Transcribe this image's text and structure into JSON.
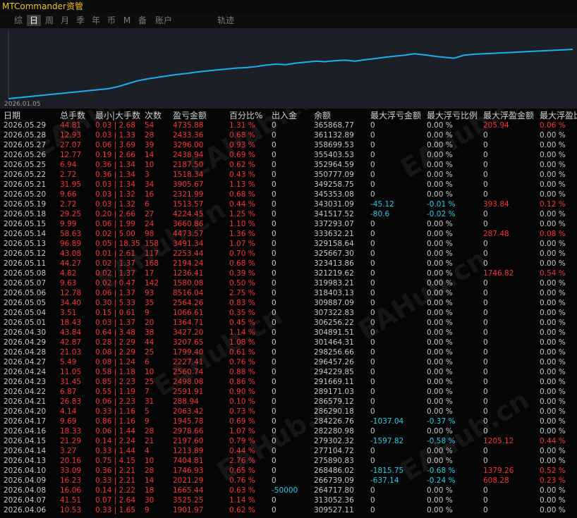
{
  "window": {
    "title": "MTCommander资管"
  },
  "tabs": [
    {
      "label": "综",
      "active": false
    },
    {
      "label": "日",
      "active": true
    },
    {
      "label": "周",
      "active": false
    },
    {
      "label": "月",
      "active": false
    },
    {
      "label": "季",
      "active": false
    },
    {
      "label": "年",
      "active": false
    },
    {
      "label": "币",
      "active": false
    },
    {
      "label": "M",
      "active": false
    },
    {
      "label": "备",
      "active": false
    },
    {
      "label": "账户",
      "active": false
    },
    {
      "label": "轨迹",
      "active": false
    }
  ],
  "chart_data": {
    "type": "line",
    "x_start_label": "2026.01.05",
    "series_color": "#1ab0f0",
    "values": [
      0.0,
      0.02,
      0.04,
      0.06,
      0.08,
      0.1,
      0.12,
      0.14,
      0.16,
      0.18,
      0.2,
      0.24,
      0.3,
      0.36,
      0.4,
      0.43,
      0.46,
      0.49,
      0.51,
      0.54,
      0.56,
      0.58,
      0.6,
      0.62,
      0.63,
      0.65,
      0.68,
      0.7,
      0.69,
      0.72,
      0.74,
      0.76,
      0.75,
      0.77,
      0.78,
      0.76,
      0.79,
      0.81,
      0.84,
      0.86,
      0.88,
      0.91,
      0.89,
      0.86,
      0.84,
      0.82,
      0.88,
      0.9,
      0.91,
      0.92,
      0.93,
      0.94,
      0.95,
      0.96,
      0.97,
      0.98,
      0.99,
      1.0
    ]
  },
  "watermark": "EAHub.cn",
  "table": {
    "headers": [
      "日期",
      "总手数",
      "最小|大手数",
      "次数",
      "盈亏金额",
      "百分比%",
      "出入金",
      "余额",
      "最大浮亏金额",
      "最大浮亏比例",
      "最大浮盈金额",
      "最大浮盈比"
    ],
    "rows": [
      [
        "2026.05.29",
        "44.81",
        "0.03 | 2.68",
        "54",
        "4735.88",
        "1.31 %",
        "0",
        "365868.77",
        "0",
        "0.00 %",
        "205.94",
        "0.06 %"
      ],
      [
        "2026.05.28",
        "12.93",
        "0.03 | 1.33",
        "28",
        "2433.36",
        "0.68 %",
        "0",
        "361132.89",
        "0",
        "0.00 %",
        "0",
        "0.00 %"
      ],
      [
        "2026.05.27",
        "27.07",
        "0.06 | 3.69",
        "39",
        "3296.00",
        "0.93 %",
        "0",
        "358699.53",
        "0",
        "0.00 %",
        "0",
        "0.00 %"
      ],
      [
        "2026.05.26",
        "12.77",
        "0.19 | 2.66",
        "14",
        "2438.94",
        "0.69 %",
        "0",
        "355403.53",
        "0",
        "0.00 %",
        "0",
        "0.00 %"
      ],
      [
        "2026.05.25",
        "6.94",
        "0.36 | 1.34",
        "10",
        "2187.50",
        "0.62 %",
        "0",
        "352964.59",
        "0",
        "0.00 %",
        "0",
        "0.00 %"
      ],
      [
        "2026.05.22",
        "2.72",
        "0.36 | 1.34",
        "3",
        "1518.34",
        "0.43 %",
        "0",
        "350777.09",
        "0",
        "0.00 %",
        "0",
        "0.00 %"
      ],
      [
        "2026.05.21",
        "31.95",
        "0.03 | 1.34",
        "34",
        "3905.67",
        "1.13 %",
        "0",
        "349258.75",
        "0",
        "0.00 %",
        "0",
        "0.00 %"
      ],
      [
        "2026.05.20",
        "9.66",
        "0.03 | 1.32",
        "16",
        "2321.99",
        "0.68 %",
        "0",
        "345353.08",
        "0",
        "0.00 %",
        "0",
        "0.00 %"
      ],
      [
        "2026.05.19",
        "2.72",
        "0.03 | 1.32",
        "6",
        "1513.57",
        "0.44 %",
        "0",
        "343031.09",
        "-45.12",
        "-0.01 %",
        "393.84",
        "0.12 %"
      ],
      [
        "2026.05.18",
        "29.25",
        "0.20 | 2.66",
        "27",
        "4224.45",
        "1.25 %",
        "0",
        "341517.52",
        "-80.6",
        "-0.02 %",
        "0",
        "0.00 %"
      ],
      [
        "2026.05.15",
        "9.99",
        "0.06 | 1.99",
        "24",
        "3660.86",
        "1.10 %",
        "0",
        "337293.07",
        "0",
        "0.00 %",
        "0",
        "0.00 %"
      ],
      [
        "2026.05.14",
        "58.63",
        "0.02 | 5.00",
        "98",
        "4473.57",
        "1.36 %",
        "0",
        "333632.21",
        "0",
        "0.00 %",
        "287.48",
        "0.08 %"
      ],
      [
        "2026.05.13",
        "96.89",
        "0.05 | 18.35",
        "158",
        "3491.34",
        "1.07 %",
        "0",
        "329158.64",
        "0",
        "0.00 %",
        "0",
        "0.00 %"
      ],
      [
        "2026.05.12",
        "43.08",
        "0.01 | 2.61",
        "117",
        "2253.44",
        "0.70 %",
        "0",
        "325667.30",
        "0",
        "0.00 %",
        "0",
        "0.00 %"
      ],
      [
        "2026.05.11",
        "44.27",
        "0.02 | 1.37",
        "168",
        "2194.24",
        "0.68 %",
        "0",
        "323413.86",
        "0",
        "0.00 %",
        "0",
        "0.00 %"
      ],
      [
        "2026.05.08",
        "4.82",
        "0.02 | 1.37",
        "17",
        "1236.41",
        "0.39 %",
        "0",
        "321219.62",
        "0",
        "0.00 %",
        "1746.82",
        "0.54 %"
      ],
      [
        "2026.05.07",
        "9.63",
        "0.02 | 0.47",
        "142",
        "1580.08",
        "0.50 %",
        "0",
        "319983.21",
        "0",
        "0.00 %",
        "0",
        "0.00 %"
      ],
      [
        "2026.05.06",
        "12.78",
        "0.06 | 1.37",
        "93",
        "8516.04",
        "2.75 %",
        "0",
        "318403.13",
        "0",
        "0.00 %",
        "0",
        "0.00 %"
      ],
      [
        "2026.05.05",
        "34.40",
        "0.30 | 5.33",
        "35",
        "2564.26",
        "0.83 %",
        "0",
        "309887.09",
        "0",
        "0.00 %",
        "0",
        "0.00 %"
      ],
      [
        "2026.05.04",
        "3.51",
        "0.15 | 0.61",
        "9",
        "1066.61",
        "0.35 %",
        "0",
        "307322.83",
        "0",
        "0.00 %",
        "0",
        "0.00 %"
      ],
      [
        "2026.05.01",
        "18.43",
        "0.03 | 1.37",
        "20",
        "1364.71",
        "0.45 %",
        "0",
        "306256.22",
        "0",
        "0.00 %",
        "0",
        "0.00 %"
      ],
      [
        "2026.04.30",
        "43.84",
        "0.64 | 3.48",
        "38",
        "3427.20",
        "1.14 %",
        "0",
        "304891.51",
        "0",
        "0.00 %",
        "0",
        "0.00 %"
      ],
      [
        "2026.04.29",
        "42.87",
        "0.28 | 2.29",
        "44",
        "3207.65",
        "1.08 %",
        "0",
        "301464.31",
        "0",
        "0.00 %",
        "0",
        "0.00 %"
      ],
      [
        "2026.04.28",
        "21.03",
        "0.08 | 2.29",
        "25",
        "1799.40",
        "0.61 %",
        "0",
        "298256.66",
        "0",
        "0.00 %",
        "0",
        "0.00 %"
      ],
      [
        "2026.04.27",
        "5.49",
        "0.08 | 1.24",
        "6",
        "2227.41",
        "0.76 %",
        "0",
        "296457.26",
        "0",
        "0.00 %",
        "0",
        "0.00 %"
      ],
      [
        "2026.04.24",
        "11.05",
        "0.58 | 1.18",
        "10",
        "2560.74",
        "0.88 %",
        "0",
        "294229.85",
        "0",
        "0.00 %",
        "0",
        "0.00 %"
      ],
      [
        "2026.04.23",
        "31.45",
        "0.85 | 2.23",
        "25",
        "2498.08",
        "0.86 %",
        "0",
        "291669.11",
        "0",
        "0.00 %",
        "0",
        "0.00 %"
      ],
      [
        "2026.04.22",
        "6.87",
        "0.55 | 1.19",
        "7",
        "2591.91",
        "0.90 %",
        "0",
        "289171.03",
        "0",
        "0.00 %",
        "0",
        "0.00 %"
      ],
      [
        "2026.04.21",
        "26.83",
        "0.06 | 2.23",
        "31",
        "288.94",
        "0.10 %",
        "0",
        "286579.12",
        "0",
        "0.00 %",
        "0",
        "0.00 %"
      ],
      [
        "2026.04.20",
        "4.14",
        "0.33 | 1.16",
        "5",
        "2063.42",
        "0.73 %",
        "0",
        "286290.18",
        "0",
        "0.00 %",
        "0",
        "0.00 %"
      ],
      [
        "2026.04.17",
        "9.69",
        "0.86 | 1.16",
        "9",
        "1945.78",
        "0.69 %",
        "0",
        "284226.76",
        "-1037.04",
        "-0.37 %",
        "0",
        "0.00 %"
      ],
      [
        "2026.04.16",
        "18.33",
        "0.06 | 1.44",
        "28",
        "2978.66",
        "1.07 %",
        "0",
        "282280.98",
        "0",
        "0.00 %",
        "0",
        "0.00 %"
      ],
      [
        "2026.04.15",
        "21.29",
        "0.14 | 2.24",
        "21",
        "2197.60",
        "0.79 %",
        "0",
        "279302.32",
        "-1597.82",
        "-0.58 %",
        "1205.12",
        "0.44 %"
      ],
      [
        "2026.04.14",
        "3.27",
        "0.33 | 1.44",
        "4",
        "1213.89",
        "0.44 %",
        "0",
        "277104.72",
        "0",
        "0.00 %",
        "0",
        "0.00 %"
      ],
      [
        "2026.04.13",
        "20.16",
        "0.75 | 4.15",
        "10",
        "7404.81",
        "2.76 %",
        "0",
        "275890.83",
        "0",
        "0.00 %",
        "0",
        "0.00 %"
      ],
      [
        "2026.04.10",
        "33.09",
        "0.36 | 2.21",
        "28",
        "1746.93",
        "0.65 %",
        "0",
        "268486.02",
        "-1815.75",
        "-0.68 %",
        "1379.26",
        "0.52 %"
      ],
      [
        "2026.04.09",
        "16.23",
        "0.33 | 2.21",
        "14",
        "2021.29",
        "0.76 %",
        "0",
        "266739.09",
        "-637.14",
        "-0.24 %",
        "608.28",
        "0.23 %"
      ],
      [
        "2026.04.08",
        "16.06",
        "0.14 | 2.22",
        "18",
        "1665.44",
        "0.63 %",
        "-50000",
        "264717.80",
        "0",
        "0.00 %",
        "0",
        "0.00 %"
      ],
      [
        "2026.04.07",
        "41.51",
        "0.07 | 2.64",
        "30",
        "3525.25",
        "1.14 %",
        "0",
        "313052.36",
        "0",
        "0.00 %",
        "0",
        "0.00 %"
      ],
      [
        "2026.04.06",
        "10.53",
        "0.33 | 1.65",
        "9",
        "1901.97",
        "0.62 %",
        "0",
        "309527.11",
        "0",
        "0.00 %",
        "0",
        "0.00 %"
      ]
    ]
  }
}
